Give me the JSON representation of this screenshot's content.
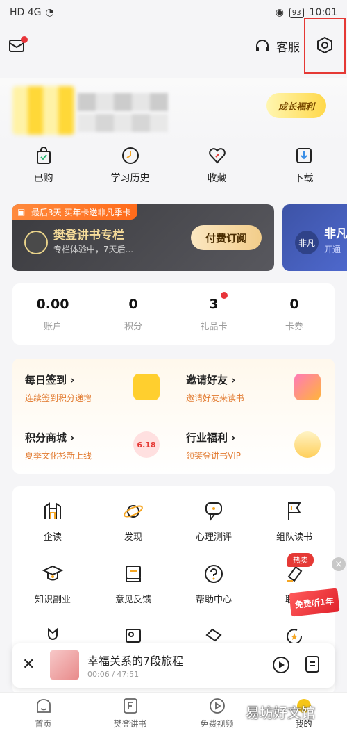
{
  "status": {
    "network": "HD 4G",
    "battery": "93",
    "time": "10:01"
  },
  "header": {
    "service_label": "客服"
  },
  "profile": {
    "growth_badge": "成长福利"
  },
  "quick": [
    {
      "label": "已购",
      "icon": "bag-check-icon"
    },
    {
      "label": "学习历史",
      "icon": "clock-icon"
    },
    {
      "label": "收藏",
      "icon": "heart-icon"
    },
    {
      "label": "下载",
      "icon": "download-icon"
    }
  ],
  "promo": {
    "tag": "最后3天 买年卡送非凡季卡",
    "title": "樊登讲书专栏",
    "subtitle": "专栏体验中，7天后...",
    "button": "付费订阅",
    "second_badge": "非凡",
    "second_title": "非凡",
    "second_sub": "开通"
  },
  "account": [
    {
      "value": "0.00",
      "label": "账户"
    },
    {
      "value": "0",
      "label": "积分"
    },
    {
      "value": "3",
      "label": "礼品卡"
    },
    {
      "value": "0",
      "label": "卡券"
    }
  ],
  "tasks": [
    {
      "title": "每日签到 ›",
      "sub": "连续签到积分递增"
    },
    {
      "title": "邀请好友 ›",
      "sub": "邀请好友来读书"
    },
    {
      "title": "积分商城 ›",
      "sub": "夏季文化衫新上线",
      "badge": "6.18"
    },
    {
      "title": "行业福利 ›",
      "sub": "领樊登讲书VIP"
    }
  ],
  "grid": [
    {
      "label": "企读"
    },
    {
      "label": "发现"
    },
    {
      "label": "心理测评"
    },
    {
      "label": "组队读书"
    },
    {
      "label": "知识副业"
    },
    {
      "label": "意见反馈"
    },
    {
      "label": "帮助中心"
    },
    {
      "label": "联合"
    }
  ],
  "hot_badge": "热卖",
  "free_badge": "免费听1年",
  "player": {
    "title": "幸福关系的7段旅程",
    "time": "00:06 / 47:51"
  },
  "tabs": [
    {
      "label": "首页"
    },
    {
      "label": "樊登讲书"
    },
    {
      "label": "免费视频"
    },
    {
      "label": "我的"
    }
  ],
  "watermark": "易坊好文馆",
  "colors": {
    "accent": "#f5a623",
    "red": "#e53935",
    "promo_dark": "#3b3b3f",
    "promo_blue": "#3d53a6"
  }
}
